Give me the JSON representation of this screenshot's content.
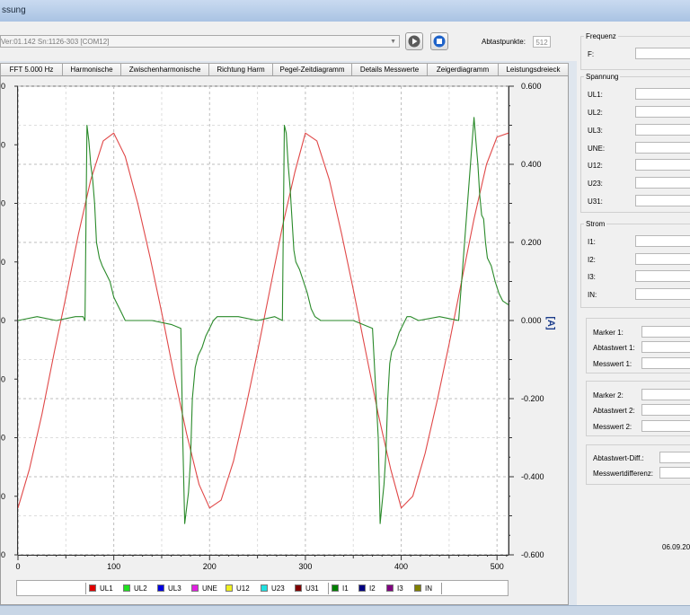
{
  "window": {
    "title": "ssung"
  },
  "toolbar": {
    "device_text": "Ver:01.142 Sn:1126-303 [COM12]",
    "abtastpunkte_label": "Abtastpunkte:",
    "abtastpunkte_value": "512"
  },
  "tabs": [
    "FFT 5.000 Hz",
    "Harmonische",
    "Zwischenharmonische",
    "Richtung Harm",
    "Pegel-Zeitdiagramm",
    "Details Messwerte",
    "Zeigerdiagramm",
    "Leistungsdreieck"
  ],
  "chart": {
    "left_ticks": [
      "0",
      "0",
      "0",
      "0",
      "0",
      "0",
      "0",
      "0",
      "0"
    ],
    "right_unit": "[A]"
  },
  "chart_data": {
    "type": "line",
    "x_ticks": [
      "0",
      "100",
      "200",
      "300",
      "400",
      "500"
    ],
    "right_ticks": [
      "0.600",
      "0.400",
      "0.200",
      "0.000",
      "-0.200",
      "-0.400",
      "-0.600"
    ],
    "xlim": [
      0,
      512
    ],
    "y2lim": [
      -0.6,
      0.6
    ],
    "grid": true,
    "legend_position": "bottom",
    "legend": [
      "UL1",
      "UL2",
      "UL3",
      "UNE",
      "U12",
      "U23",
      "U31",
      "I1",
      "I2",
      "I3",
      "IN"
    ],
    "series": [
      {
        "name": "UL1",
        "color": "#e04848",
        "axis": "right",
        "x": [
          0,
          12,
          25,
          38,
          50,
          63,
          76,
          89,
          100,
          112,
          125,
          138,
          150,
          163,
          176,
          189,
          200,
          212,
          225,
          238,
          250,
          263,
          276,
          289,
          300,
          312,
          325,
          338,
          350,
          363,
          376,
          389,
          400,
          412,
          425,
          438,
          450,
          463,
          476,
          489,
          500,
          512
        ],
        "y": [
          -0.48,
          -0.38,
          -0.24,
          -0.08,
          0.06,
          0.22,
          0.36,
          0.46,
          0.48,
          0.42,
          0.3,
          0.16,
          0.02,
          -0.14,
          -0.29,
          -0.42,
          -0.48,
          -0.46,
          -0.36,
          -0.22,
          -0.08,
          0.08,
          0.24,
          0.38,
          0.48,
          0.46,
          0.36,
          0.22,
          0.08,
          -0.08,
          -0.24,
          -0.38,
          -0.48,
          -0.45,
          -0.34,
          -0.2,
          -0.06,
          0.1,
          0.26,
          0.4,
          0.47,
          0.48
        ]
      },
      {
        "name": "I1",
        "color": "#2a8a2a",
        "axis": "right",
        "x": [
          0,
          20,
          40,
          60,
          68,
          70,
          72,
          74,
          76,
          78,
          80,
          82,
          85,
          88,
          92,
          96,
          100,
          104,
          108,
          112,
          120,
          140,
          160,
          170,
          172,
          174,
          176,
          178,
          180,
          182,
          185,
          188,
          192,
          196,
          200,
          204,
          208,
          215,
          230,
          250,
          268,
          276,
          278,
          280,
          282,
          284,
          286,
          288,
          290,
          294,
          298,
          302,
          306,
          310,
          316,
          330,
          350,
          370,
          376,
          378,
          380,
          382,
          384,
          386,
          388,
          390,
          394,
          398,
          402,
          406,
          410,
          418,
          440,
          460,
          476,
          478,
          480,
          482,
          484,
          486,
          488,
          490,
          494,
          498,
          502,
          506,
          512
        ],
        "y": [
          0.0,
          0.01,
          0.0,
          0.01,
          0.01,
          0.0,
          0.5,
          0.46,
          0.4,
          0.36,
          0.3,
          0.2,
          0.16,
          0.14,
          0.12,
          0.1,
          0.06,
          0.04,
          0.02,
          0.0,
          0.0,
          0.0,
          -0.01,
          -0.02,
          -0.3,
          -0.52,
          -0.48,
          -0.44,
          -0.36,
          -0.2,
          -0.12,
          -0.09,
          -0.07,
          -0.04,
          -0.02,
          0.0,
          0.01,
          0.01,
          0.01,
          0.0,
          0.01,
          0.0,
          0.5,
          0.48,
          0.4,
          0.34,
          0.26,
          0.18,
          0.15,
          0.13,
          0.1,
          0.07,
          0.03,
          0.01,
          0.0,
          0.0,
          0.0,
          -0.02,
          -0.3,
          -0.52,
          -0.47,
          -0.42,
          -0.34,
          -0.2,
          -0.11,
          -0.08,
          -0.06,
          -0.03,
          -0.01,
          0.01,
          0.01,
          0.0,
          0.01,
          0.0,
          0.52,
          0.46,
          0.4,
          0.32,
          0.27,
          0.26,
          0.2,
          0.16,
          0.14,
          0.1,
          0.07,
          0.05,
          0.04
        ]
      }
    ]
  },
  "right": {
    "frequenz_title": "Frequenz",
    "f_label": "F:",
    "spannung_title": "Spannung",
    "spannung_labels": [
      "UL1:",
      "UL2:",
      "UL3:",
      "UNE:",
      "U12:",
      "U23:",
      "U31:"
    ],
    "strom_title": "Strom",
    "strom_labels": [
      "I1:",
      "I2:",
      "I3:",
      "IN:"
    ],
    "marker1": [
      "Marker 1:",
      "Abtastwert 1:",
      "Messwert 1:"
    ],
    "marker2": [
      "Marker 2:",
      "Abtastwert 2:",
      "Messwert 2:"
    ],
    "diff": [
      "Abtastwert-Diff.:",
      "Messwertdifferenz:"
    ],
    "date": "06.09.20"
  },
  "colors": {
    "UL1": "#e00000",
    "UL2": "#20e020",
    "UL3": "#0000e0",
    "UNE": "#e020e0",
    "U12": "#f0f020",
    "U23": "#20e0e0",
    "U31": "#800000",
    "I1": "#008000",
    "I2": "#000080",
    "I3": "#800080",
    "IN": "#808000"
  }
}
